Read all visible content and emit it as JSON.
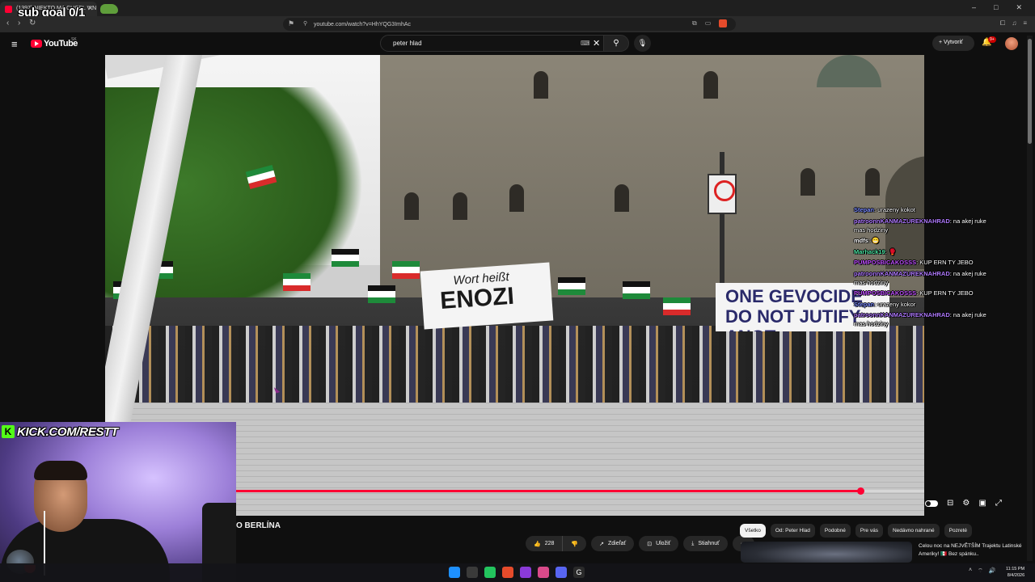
{
  "browser": {
    "tab_title": "(1397) NIEKTO MA CHCEL V N",
    "url": "youtube.com/watch?v=HhYQG3ImhAc",
    "window_controls": [
      "–",
      "□",
      "✕"
    ]
  },
  "stream_overlay": {
    "sub_goal": "sub goal 0/1",
    "kick_handle": "KICK.COM/RESTT",
    "kick_logo_letter": "K"
  },
  "youtube": {
    "logo_text": "YouTube",
    "country_code": "SK",
    "search_query": "peter hlad",
    "create_label": "Vytvoriť",
    "notification_count": "9+",
    "video_title": "O BERLÍNA",
    "likes": "228",
    "share_label": "Zdieľať",
    "save_label": "Uložiť",
    "download_label": "Stiahnuť",
    "more_label": "···",
    "progress_fraction": 0.907,
    "filter_chips": [
      "Všetko",
      "Od: Peter Hlad",
      "Podobné",
      "Pre vás",
      "Nedávno nahrané",
      "Pozreté"
    ],
    "active_chip": "Všetko",
    "recommended": {
      "title": "Celou noc na NEJVĚTŠÍM Trajektu Latinské Ameriky! 🇲🇽 Bez spánku.."
    }
  },
  "video_scene": {
    "banner_left_small": "Wort heißt",
    "banner_left_big": "ENOZI",
    "banner_right": "ONE GEVOCIDE DO NOT JUTIFY ANOT"
  },
  "chat": [
    {
      "user": "Stepan",
      "message": "urazeny kokot",
      "color": "#7b8cff"
    },
    {
      "user": "patroonnKANMAZUREKNAHRAD",
      "message": "na akej ruke mas hodziny",
      "color": "#b07aff"
    },
    {
      "user": "mdfs",
      "message": "😁",
      "color": "#ffffff"
    },
    {
      "user": "Marhack19",
      "message": "🥊",
      "color": "#4be0a0"
    },
    {
      "user": "PUMPOSBICAKOSSS",
      "message": "KUP ERN TY JEBO",
      "color": "#c050ff"
    },
    {
      "user": "patroonnKANMAZUREKNAHRAD",
      "message": "na akej ruke mas hodziny",
      "color": "#b07aff"
    },
    {
      "user": "PUMPOSBICAKOSSS",
      "message": "KUP ERN TY JEBO",
      "color": "#c050ff"
    },
    {
      "user": "Stepan",
      "message": "urazeny kokor",
      "color": "#7b8cff"
    },
    {
      "user": "patroonnKANMAZUREKNAHRAD",
      "message": "na akej ruke mas hodziny",
      "color": "#b07aff"
    }
  ],
  "taskbar": {
    "time": "11:15 PM",
    "date": "8/4/2026"
  },
  "colors": {
    "yt_red": "#ff0033",
    "kick_green": "#53fc18",
    "page_bg": "#0f0f0f"
  }
}
